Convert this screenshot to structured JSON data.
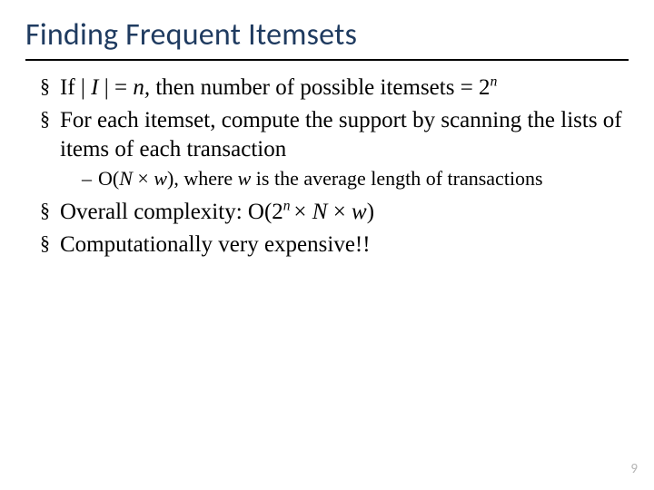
{
  "title": "Finding Frequent Itemsets",
  "bullets": {
    "b1_pre": "If | ",
    "b1_I": "I",
    "b1_mid": " | = ",
    "b1_n": "n,",
    "b1_post": " then number of possible itemsets = 2",
    "b1_sup": "n",
    "b2": "For each itemset, compute the support by scanning the lists of items of each transaction",
    "b2_sub_pre": "O(",
    "b2_sub_N": "N",
    "b2_sub_times": " × ",
    "b2_sub_w": "w",
    "b2_sub_mid": "), where ",
    "b2_sub_w2": "w",
    "b2_sub_post": " is the average length of transactions",
    "b3_pre": "Overall complexity: O(2",
    "b3_sup": "n ",
    "b3_mid1": "× ",
    "b3_N": "N ",
    "b3_times2": " ×  ",
    "b3_w": "w",
    "b3_end": ")",
    "b4": "Computationally very expensive!!"
  },
  "page_number": "9"
}
